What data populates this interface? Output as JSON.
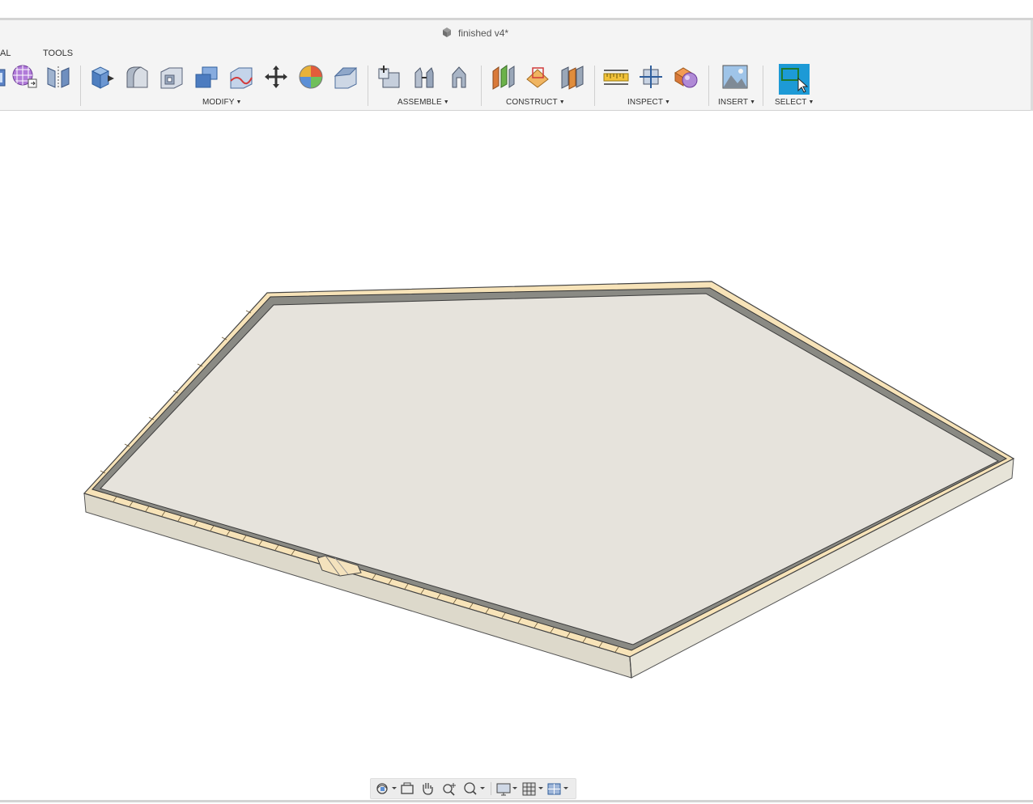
{
  "window": {
    "title": "finished v4*"
  },
  "tabs": {
    "partial": "AL",
    "tools": "TOOLS"
  },
  "groups": {
    "modify": "MODIFY",
    "assemble": "ASSEMBLE",
    "construct": "CONSTRUCT",
    "inspect": "INSPECT",
    "insert": "INSERT",
    "select": "SELECT"
  },
  "icons": {
    "left": [
      "sketch-partial-icon",
      "mesh-grid-icon",
      "mirror-icon"
    ],
    "modify": [
      "press-pull-icon",
      "fillet-icon",
      "shell-icon",
      "combine-icon",
      "replace-face-icon",
      "move-icon",
      "appearance-icon",
      "chamfer-icon"
    ],
    "assemble": [
      "new-component-icon",
      "joint-icon",
      "as-built-joint-icon"
    ],
    "construct": [
      "offset-plane-icon",
      "plane-at-angle-icon",
      "midplane-icon"
    ],
    "inspect": [
      "measure-icon",
      "section-analysis-icon",
      "interference-icon"
    ],
    "insert": [
      "insert-image-icon"
    ],
    "select": [
      "select-window-icon"
    ]
  },
  "navbar": [
    "orbit-icon",
    "look-at-icon",
    "pan-icon",
    "zoom-icon",
    "fit-icon",
    "display-settings-icon",
    "grid-icon",
    "viewports-icon"
  ],
  "colors": {
    "toolbar_bg": "#f4f4f4",
    "select_accent": "#1d9ad6",
    "model_face": "#e6e3dc",
    "model_wall": "#ddd9cb",
    "model_trim": "#f7e3b8"
  }
}
